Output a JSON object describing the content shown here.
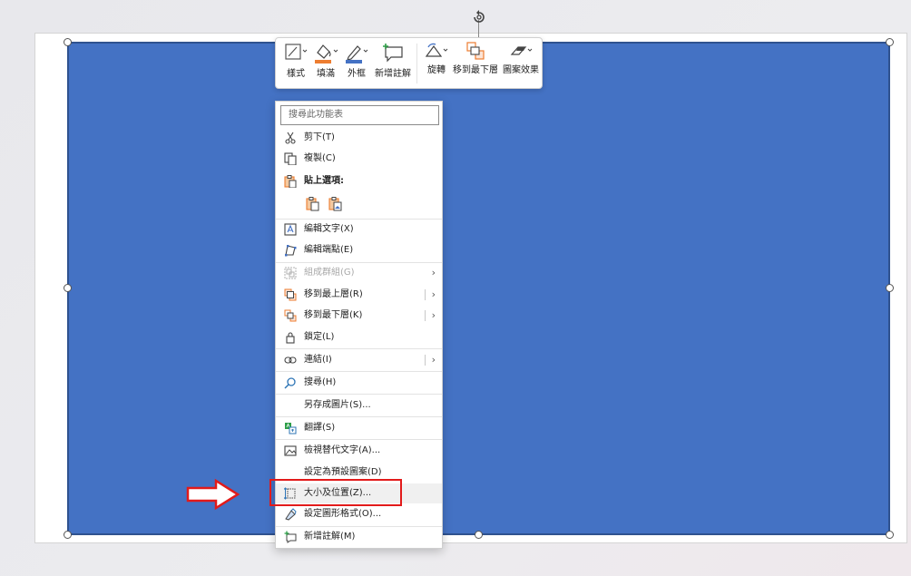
{
  "toolbar": {
    "style_label": "樣式",
    "fill_label": "填滿",
    "outline_label": "外框",
    "new_comment_label": "新增註解",
    "rotate_label": "旋轉",
    "send_back_label": "移到最下層",
    "effects_label": "圖案效果"
  },
  "menu": {
    "search_placeholder": "搜尋此功能表",
    "cut": "剪下(T)",
    "copy": "複製(C)",
    "paste_options": "貼上選項:",
    "edit_text": "編輯文字(X)",
    "edit_points": "編輯端點(E)",
    "group": "組成群組(G)",
    "bring_to_front": "移到最上層(R)",
    "send_to_back": "移到最下層(K)",
    "lock": "鎖定(L)",
    "link": "連結(I)",
    "search": "搜尋(H)",
    "save_as_picture": "另存成圖片(S)...",
    "translate": "翻譯(S)",
    "view_alt_text": "檢視替代文字(A)...",
    "set_default_shape": "設定為預設圖案(D)",
    "size_position": "大小及位置(Z)...",
    "format_shape": "設定圖形格式(O)...",
    "new_comment": "新增註解(M)"
  },
  "colors": {
    "shape_fill": "#4472c4",
    "shape_border": "#2f528f",
    "fill_swatch": "#ed7d31",
    "outline_swatch": "#4472c4",
    "annotation_red": "#e21a1a"
  }
}
